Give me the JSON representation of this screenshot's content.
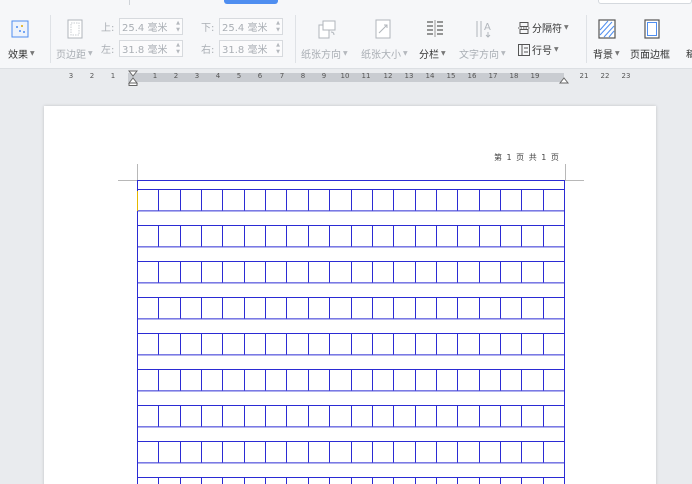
{
  "ribbon": {
    "effects_label": "效果",
    "margins_label": "页边距",
    "margin_top_label": "上:",
    "margin_top_value": "25.4 毫米",
    "margin_bottom_label": "下:",
    "margin_bottom_value": "25.4 毫米",
    "margin_left_label": "左:",
    "margin_left_value": "31.8 毫米",
    "margin_right_label": "右:",
    "margin_right_value": "31.8 毫米",
    "orientation_label": "纸张方向",
    "size_label": "纸张大小",
    "columns_label": "分栏",
    "text_direction_label": "文字方向",
    "breaks_label": "分隔符",
    "line_numbers_label": "行号",
    "background_label": "背景",
    "page_border_label": "页面边框"
  },
  "ruler": {
    "ticks": [
      "3",
      "2",
      "1",
      "1",
      "2",
      "3",
      "4",
      "5",
      "6",
      "7",
      "8",
      "9",
      "10",
      "11",
      "12",
      "13",
      "14",
      "15",
      "16",
      "17",
      "18",
      "19",
      "21",
      "22",
      "23"
    ]
  },
  "page": {
    "header_text": "第 1 页 共 1 页"
  },
  "grid": {
    "columns": 20,
    "rows": 9,
    "line_color": "#2b2bd4"
  },
  "colors": {
    "accent": "#4f8ef0",
    "disabled_text": "#a9aeb4"
  }
}
